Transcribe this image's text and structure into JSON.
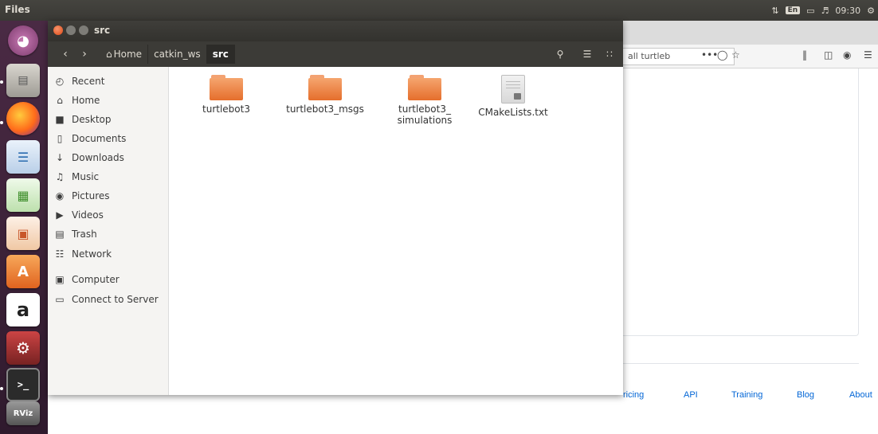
{
  "top_panel": {
    "app_name": "Files",
    "keyboard_layout": "En",
    "clock": "09:30"
  },
  "launcher": {
    "amazon_letter": "a",
    "rviz_label": "RViz"
  },
  "browser": {
    "url_text": "all turtleb",
    "url_more": "•••",
    "footer_links": [
      "ricing",
      "API",
      "Training",
      "Blog",
      "About"
    ]
  },
  "window": {
    "title": "src",
    "breadcrumbs": [
      "Home",
      "catkin_ws",
      "src"
    ]
  },
  "sidebar": {
    "items": [
      {
        "label": "Recent",
        "icon": "clock-icon",
        "glyph": "◴"
      },
      {
        "label": "Home",
        "icon": "home-icon",
        "glyph": "⌂"
      },
      {
        "label": "Desktop",
        "icon": "folder-icon",
        "glyph": "■"
      },
      {
        "label": "Documents",
        "icon": "document-icon",
        "glyph": "▯"
      },
      {
        "label": "Downloads",
        "icon": "download-icon",
        "glyph": "↓"
      },
      {
        "label": "Music",
        "icon": "music-icon",
        "glyph": "♫"
      },
      {
        "label": "Pictures",
        "icon": "camera-icon",
        "glyph": "◉"
      },
      {
        "label": "Videos",
        "icon": "video-icon",
        "glyph": "▶"
      },
      {
        "label": "Trash",
        "icon": "trash-icon",
        "glyph": "▤"
      },
      {
        "label": "Network",
        "icon": "network-icon",
        "glyph": "☷"
      },
      {
        "label": "Computer",
        "icon": "computer-icon",
        "glyph": "▣"
      },
      {
        "label": "Connect to Server",
        "icon": "server-icon",
        "glyph": "▭"
      }
    ]
  },
  "files": [
    {
      "name": "turtlebot3",
      "type": "folder"
    },
    {
      "name": "turtlebot3_msgs",
      "type": "folder"
    },
    {
      "name_line1": "turtlebot3_",
      "name_line2": "simulations",
      "type": "folder"
    },
    {
      "name": "CMakeLists.txt",
      "type": "text-file"
    }
  ],
  "colors": {
    "panel": "#3c3b37",
    "launcher": "#3b2137",
    "folder": "#e56e2c",
    "close_button": "#df4a16",
    "link": "#0366d6"
  }
}
